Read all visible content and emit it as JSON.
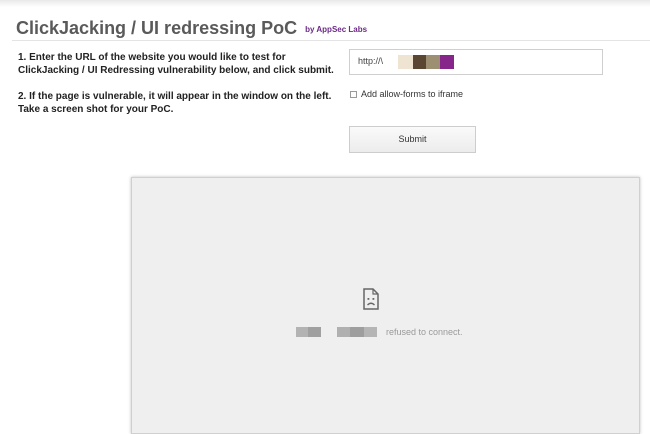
{
  "header": {
    "title": "ClickJacking / UI redressing PoC",
    "byline": "by AppSec Labs"
  },
  "instructions": {
    "step1": "1. Enter the URL of the website you would like to test for ClickJacking / UI Redressing vulnerability below, and click submit.",
    "step2": "2. If the page is vulnerable, it will appear in the window on the left. Take a screen shot for your PoC."
  },
  "form": {
    "url_value": "http://\\",
    "allow_forms_label": "Add allow-forms to iframe",
    "allow_forms_checked": false,
    "submit_label": "Submit"
  },
  "iframe_preview": {
    "error_icon": "sad-page-icon",
    "error_text": "refused to connect."
  },
  "colors": {
    "title": "#5a5a5a",
    "byline": "#6b2a86",
    "frame_background": "#efefef",
    "redaction": [
      "#efe3d2",
      "#5a4632",
      "#9c8f72",
      "#86258a",
      "#b0b0b0"
    ]
  }
}
